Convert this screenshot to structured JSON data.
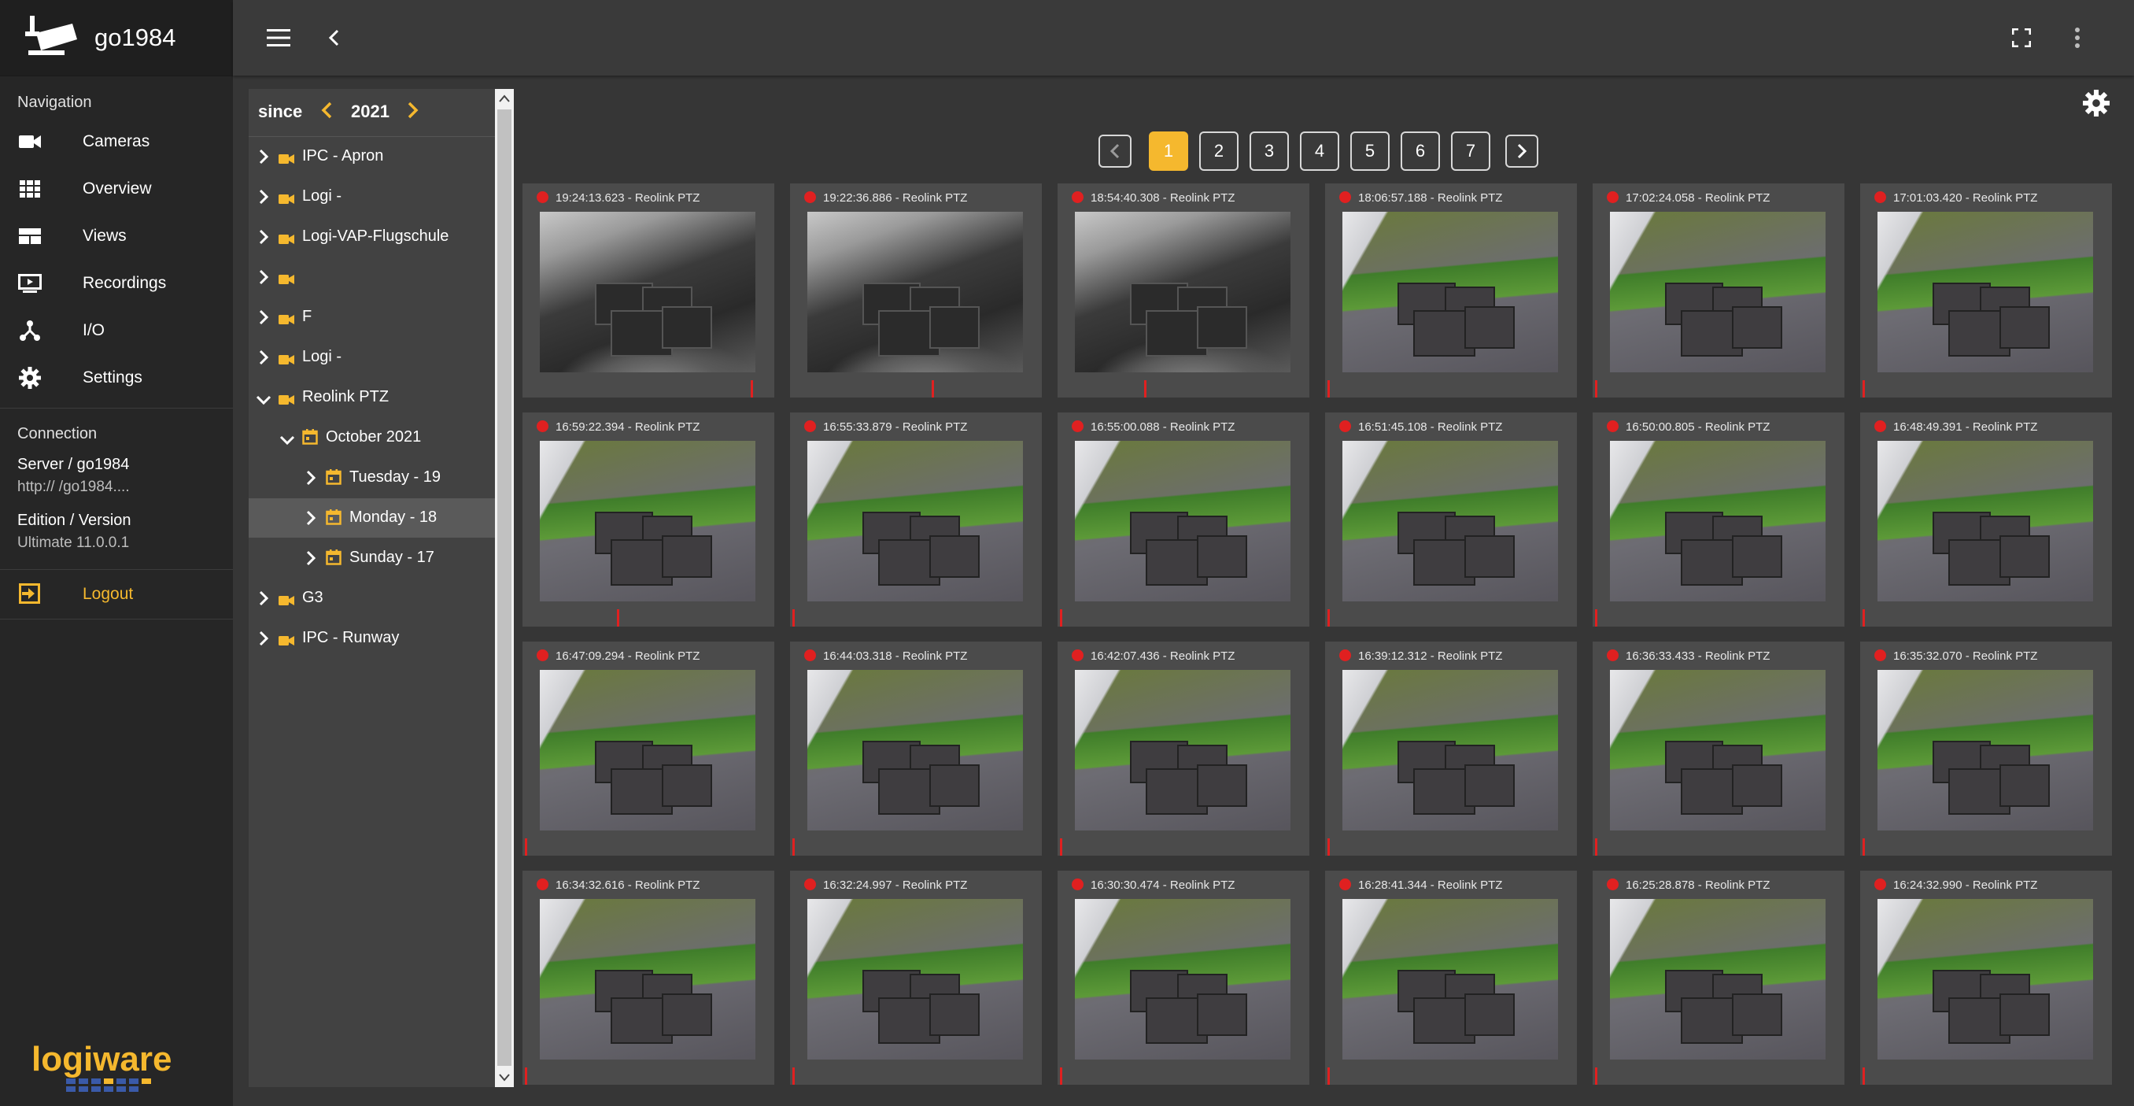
{
  "app": {
    "title": "go1984"
  },
  "nav": {
    "section_title": "Navigation",
    "items": [
      {
        "label": "Cameras",
        "icon": "video-camera-icon"
      },
      {
        "label": "Overview",
        "icon": "grid-icon"
      },
      {
        "label": "Views",
        "icon": "views-icon"
      },
      {
        "label": "Recordings",
        "icon": "play-box-icon"
      },
      {
        "label": "I/O",
        "icon": "io-network-icon"
      },
      {
        "label": "Settings",
        "icon": "gear-icon"
      }
    ],
    "connection_title": "Connection",
    "server_label": "Server / go1984",
    "server_value": "http://                  /go1984....",
    "edition_label": "Edition / Version",
    "edition_value": "Ultimate 11.0.0.1",
    "logout_label": "Logout",
    "brand": "logiware"
  },
  "tree": {
    "since_label": "since",
    "year": "2021",
    "nodes": [
      {
        "label": "IPC - Apron",
        "level": 0,
        "type": "camera",
        "expanded": false
      },
      {
        "label": "Logi - ",
        "level": 0,
        "type": "camera",
        "expanded": false
      },
      {
        "label": "Logi-VAP-Flugschule",
        "level": 0,
        "type": "camera",
        "expanded": false
      },
      {
        "label": "",
        "level": 0,
        "type": "camera",
        "expanded": false
      },
      {
        "label": "F",
        "level": 0,
        "type": "camera",
        "expanded": false
      },
      {
        "label": "Logi - ",
        "level": 0,
        "type": "camera",
        "expanded": false
      },
      {
        "label": "Reolink PTZ",
        "level": 0,
        "type": "camera",
        "expanded": true
      },
      {
        "label": "October 2021",
        "level": 1,
        "type": "calendar",
        "expanded": true
      },
      {
        "label": "Tuesday - 19",
        "level": 2,
        "type": "calendar",
        "expanded": false
      },
      {
        "label": "Monday - 18",
        "level": 2,
        "type": "calendar",
        "expanded": false,
        "selected": true
      },
      {
        "label": "Sunday - 17",
        "level": 2,
        "type": "calendar",
        "expanded": false
      },
      {
        "label": "G3",
        "level": 0,
        "type": "camera",
        "expanded": false
      },
      {
        "label": "IPC - Runway",
        "level": 0,
        "type": "camera",
        "expanded": false
      }
    ]
  },
  "pager": {
    "pages": [
      "1",
      "2",
      "3",
      "4",
      "5",
      "6",
      "7"
    ],
    "active": "1"
  },
  "recordings": [
    {
      "caption": "19:24:13.623 - Reolink PTZ",
      "scene": "night"
    },
    {
      "caption": "19:22:36.886 - Reolink PTZ",
      "scene": "night"
    },
    {
      "caption": "18:54:40.308 - Reolink PTZ",
      "scene": "night"
    },
    {
      "caption": "18:06:57.188 - Reolink PTZ",
      "scene": "day"
    },
    {
      "caption": "17:02:24.058 - Reolink PTZ",
      "scene": "day"
    },
    {
      "caption": "17:01:03.420 - Reolink PTZ",
      "scene": "day"
    },
    {
      "caption": "16:59:22.394 - Reolink PTZ",
      "scene": "day"
    },
    {
      "caption": "16:55:33.879 - Reolink PTZ",
      "scene": "day"
    },
    {
      "caption": "16:55:00.088 - Reolink PTZ",
      "scene": "day"
    },
    {
      "caption": "16:51:45.108 - Reolink PTZ",
      "scene": "day"
    },
    {
      "caption": "16:50:00.805 - Reolink PTZ",
      "scene": "day"
    },
    {
      "caption": "16:48:49.391 - Reolink PTZ",
      "scene": "day"
    },
    {
      "caption": "16:47:09.294 - Reolink PTZ",
      "scene": "day"
    },
    {
      "caption": "16:44:03.318 - Reolink PTZ",
      "scene": "day"
    },
    {
      "caption": "16:42:07.436 - Reolink PTZ",
      "scene": "day"
    },
    {
      "caption": "16:39:12.312 - Reolink PTZ",
      "scene": "day"
    },
    {
      "caption": "16:36:33.433 - Reolink PTZ",
      "scene": "day"
    },
    {
      "caption": "16:35:32.070 - Reolink PTZ",
      "scene": "day"
    },
    {
      "caption": "16:34:32.616 - Reolink PTZ",
      "scene": "day"
    },
    {
      "caption": "16:32:24.997 - Reolink PTZ",
      "scene": "day"
    },
    {
      "caption": "16:30:30.474 - Reolink PTZ",
      "scene": "day"
    },
    {
      "caption": "16:28:41.344 - Reolink PTZ",
      "scene": "day"
    },
    {
      "caption": "16:25:28.878 - Reolink PTZ",
      "scene": "day"
    },
    {
      "caption": "16:24:32.990 - Reolink PTZ",
      "scene": "day"
    }
  ],
  "colors": {
    "accent": "#f5b82e",
    "recording": "#e02020",
    "nav_bg": "#262626",
    "content_bg": "#363636"
  }
}
